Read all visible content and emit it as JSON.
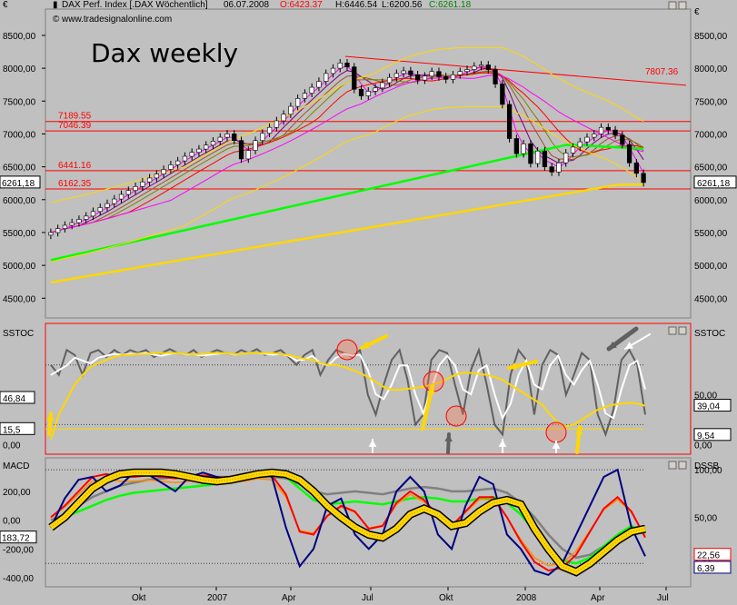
{
  "header": {
    "currency": "€",
    "instrument": "DAX Perf. Index [.DAX Wöchentlich]",
    "date": "06.07.2008",
    "open": "O:6423.37",
    "high": "H:6446.54",
    "low": "L:6200.56",
    "close": "C:6261.18",
    "credit": "www.tradesignalonline.com"
  },
  "chart_data": [
    {
      "type": "candlestick",
      "title": "Dax weekly",
      "ylim": [
        4200,
        8900
      ],
      "y_ticks": [
        "8500,00",
        "8000,00",
        "7500,00",
        "7000,00",
        "6500,00",
        "6000,00",
        "5500,00",
        "5000,00",
        "4500,00"
      ],
      "x_ticks": [
        "Okt",
        "2007",
        "Apr",
        "Jul",
        "Okt",
        "2008",
        "Apr",
        "Jul"
      ],
      "current_label": "6261,18",
      "levels": [
        {
          "value": 7189.55,
          "label": "7189.55"
        },
        {
          "value": 7046.39,
          "label": "7046.39"
        },
        {
          "value": 6441.16,
          "label": "6441.16"
        },
        {
          "value": 6162.35,
          "label": "6162.35"
        }
      ],
      "trendline": {
        "label": "7807.36",
        "from": 8180,
        "to": 7740
      },
      "closes": [
        5500,
        5560,
        5610,
        5650,
        5700,
        5750,
        5820,
        5880,
        5940,
        6010,
        6080,
        6140,
        6200,
        6270,
        6330,
        6390,
        6460,
        6530,
        6590,
        6660,
        6720,
        6770,
        6830,
        6890,
        6950,
        7000,
        6900,
        6620,
        6750,
        6900,
        7010,
        7100,
        7200,
        7300,
        7420,
        7540,
        7620,
        7710,
        7800,
        7920,
        8000,
        8080,
        8020,
        7680,
        7580,
        7650,
        7700,
        7780,
        7860,
        7920,
        7960,
        7900,
        7820,
        7880,
        7950,
        7870,
        7830,
        7900,
        7950,
        7980,
        8030,
        8050,
        7980,
        7760,
        7450,
        6930,
        6700,
        6850,
        6550,
        6740,
        6500,
        6420,
        6560,
        6710,
        6800,
        6880,
        6950,
        7000,
        7100,
        7060,
        6980,
        6840,
        6560,
        6400,
        6261
      ]
    },
    {
      "type": "line",
      "title": "SSTOC",
      "ylim": [
        -8,
        120
      ],
      "left_labels": [
        "46,84",
        "15,5",
        "0,00"
      ],
      "right_labels": [
        "50,00",
        "0,00"
      ],
      "right_values": [
        "39,04",
        "9,54"
      ],
      "fast": [
        80,
        70,
        95,
        90,
        70,
        92,
        95,
        88,
        95,
        90,
        95,
        92,
        95,
        88,
        92,
        96,
        92,
        90,
        95,
        88,
        92,
        95,
        92,
        90,
        95,
        92,
        96,
        90,
        92,
        95,
        88,
        80,
        90,
        95,
        70,
        85,
        95,
        92,
        88,
        95,
        50,
        30,
        60,
        85,
        95,
        65,
        20,
        30,
        85,
        95,
        92,
        60,
        30,
        75,
        95,
        60,
        20,
        10,
        70,
        95,
        85,
        30,
        80,
        95,
        90,
        50,
        70,
        92,
        85,
        30,
        10,
        35,
        85,
        95,
        80,
        30
      ],
      "slow": [
        70,
        75,
        80,
        88,
        85,
        82,
        88,
        90,
        92,
        91,
        92,
        92,
        93,
        91,
        90,
        92,
        93,
        91,
        92,
        90,
        91,
        92,
        93,
        91,
        92,
        93,
        93,
        92,
        91,
        92,
        90,
        85,
        86,
        90,
        82,
        80,
        88,
        92,
        90,
        91,
        75,
        50,
        45,
        60,
        80,
        80,
        50,
        30,
        55,
        80,
        90,
        80,
        55,
        50,
        75,
        80,
        50,
        25,
        40,
        70,
        85,
        60,
        55,
        80,
        90,
        70,
        60,
        75,
        85,
        60,
        30,
        25,
        55,
        80,
        85,
        55
      ],
      "slowlong": [
        5,
        30,
        45,
        60,
        70,
        78,
        82,
        85,
        88,
        90,
        90,
        91,
        91,
        92,
        92,
        92,
        92,
        91,
        91,
        91,
        92,
        92,
        92,
        91,
        91,
        92,
        92,
        92,
        92,
        91,
        90,
        88,
        86,
        85,
        82,
        80,
        80,
        78,
        75,
        72,
        68,
        63,
        58,
        55,
        55,
        56,
        57,
        58,
        60,
        62,
        66,
        70,
        72,
        72,
        71,
        70,
        68,
        65,
        60,
        55,
        50,
        45,
        40,
        30,
        22,
        18,
        20,
        25,
        30,
        35,
        38,
        40,
        41,
        42,
        41,
        39
      ]
    },
    {
      "type": "line",
      "title": "MACD",
      "right_title": "DSSB",
      "ylim": [
        -450,
        420
      ],
      "left_labels": [
        "200,00",
        "0,00",
        "-200,00",
        "-400,00"
      ],
      "left_value": "183,72",
      "right_labels": [
        "100,00",
        "50,00",
        "0,00"
      ],
      "right_values": [
        "22,56",
        "6,39"
      ],
      "thick": [
        -50,
        20,
        120,
        220,
        280,
        320,
        330,
        330,
        330,
        320,
        300,
        280,
        270,
        280,
        300,
        320,
        330,
        320,
        280,
        200,
        100,
        20,
        -50,
        -100,
        -120,
        -60,
        40,
        80,
        40,
        -40,
        -20,
        60,
        120,
        140,
        110,
        -60,
        -200,
        -320,
        -360,
        -300,
        -220,
        -140,
        -80,
        -60
      ],
      "blue": [
        -50,
        150,
        280,
        300,
        200,
        240,
        330,
        320,
        260,
        200,
        300,
        330,
        300,
        280,
        320,
        340,
        300,
        -50,
        -320,
        -200,
        100,
        150,
        -100,
        -200,
        -100,
        200,
        300,
        200,
        -100,
        -200,
        100,
        300,
        250,
        -100,
        -200,
        -350,
        -380,
        -300,
        -100,
        100,
        300,
        350,
        -50,
        -250
      ],
      "red": [
        20,
        100,
        200,
        300,
        320,
        300,
        300,
        310,
        300,
        290,
        300,
        310,
        300,
        290,
        300,
        320,
        310,
        180,
        -80,
        -100,
        30,
        100,
        60,
        -60,
        -40,
        120,
        200,
        140,
        30,
        -40,
        60,
        160,
        160,
        20,
        -150,
        -290,
        -350,
        -330,
        -240,
        -80,
        80,
        160,
        60,
        -120
      ],
      "green": [
        -30,
        20,
        60,
        100,
        140,
        170,
        190,
        200,
        210,
        220,
        230,
        240,
        250,
        260,
        280,
        300,
        310,
        300,
        220,
        140,
        110,
        120,
        130,
        120,
        110,
        130,
        150,
        160,
        150,
        130,
        130,
        150,
        160,
        120,
        40,
        -80,
        -200,
        -280,
        -300,
        -260,
        -180,
        -100,
        -40,
        -80
      ],
      "gray": [
        0,
        40,
        100,
        160,
        200,
        240,
        260,
        280,
        290,
        300,
        300,
        300,
        300,
        300,
        300,
        300,
        300,
        290,
        250,
        200,
        180,
        190,
        200,
        190,
        180,
        200,
        220,
        230,
        220,
        200,
        200,
        210,
        220,
        190,
        120,
        20,
        -100,
        -200,
        -260,
        -240,
        -180,
        -120,
        -60,
        -40
      ]
    }
  ]
}
